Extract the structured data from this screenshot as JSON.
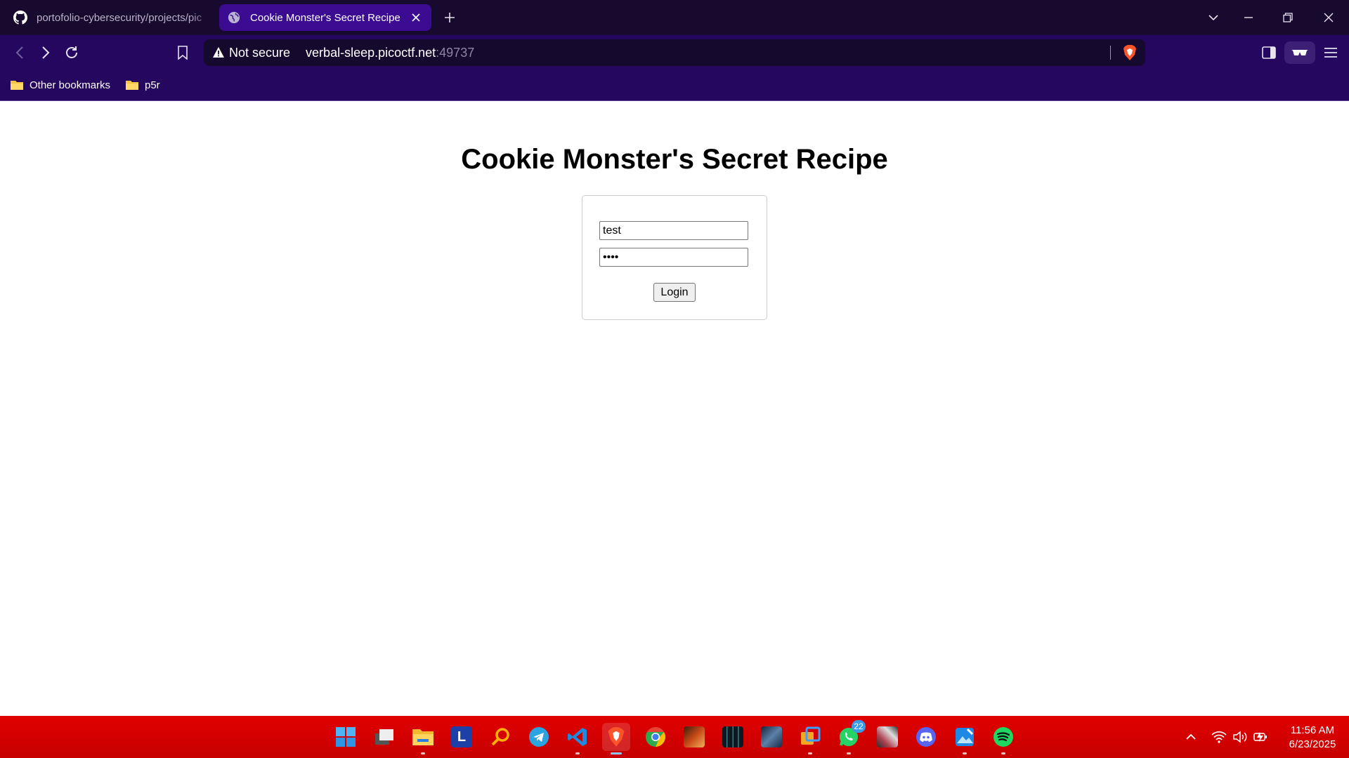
{
  "browser": {
    "tabs": [
      {
        "title": "portofolio-cybersecurity/projects/pic",
        "active": false,
        "icon": "github-icon"
      },
      {
        "title": "Cookie Monster's Secret Recipe",
        "active": true,
        "icon": "globe-icon"
      }
    ],
    "address_bar": {
      "security_label": "Not secure",
      "host": "verbal-sleep.picoctf.net",
      "port": ":49737"
    },
    "bookmarks": [
      {
        "label": "Other bookmarks",
        "icon": "folder-icon"
      },
      {
        "label": "p5r",
        "icon": "folder-icon"
      }
    ],
    "colors": {
      "tabstrip": "#170a2e",
      "toolbar": "#25075f",
      "active_tab": "#3b0c91"
    }
  },
  "page": {
    "title": "Cookie Monster's Secret Recipe",
    "form": {
      "username_value": "test",
      "password_value": "test",
      "login_label": "Login"
    }
  },
  "taskbar": {
    "apps": [
      "windows-start-icon",
      "task-view-icon",
      "file-explorer-icon",
      "l-app-icon",
      "search-magnifier-icon",
      "telegram-icon",
      "vscode-icon",
      "brave-icon",
      "chrome-icon",
      "game-icon-1",
      "game-icon-2",
      "game-icon-3",
      "app-icon-orange",
      "whatsapp-icon",
      "game-icon-4",
      "discord-icon",
      "photos-icon",
      "spotify-icon"
    ],
    "whatsapp_badge": "22",
    "clock": {
      "time": "11:56 AM",
      "date": "6/23/2025"
    },
    "color": "#d90000"
  }
}
